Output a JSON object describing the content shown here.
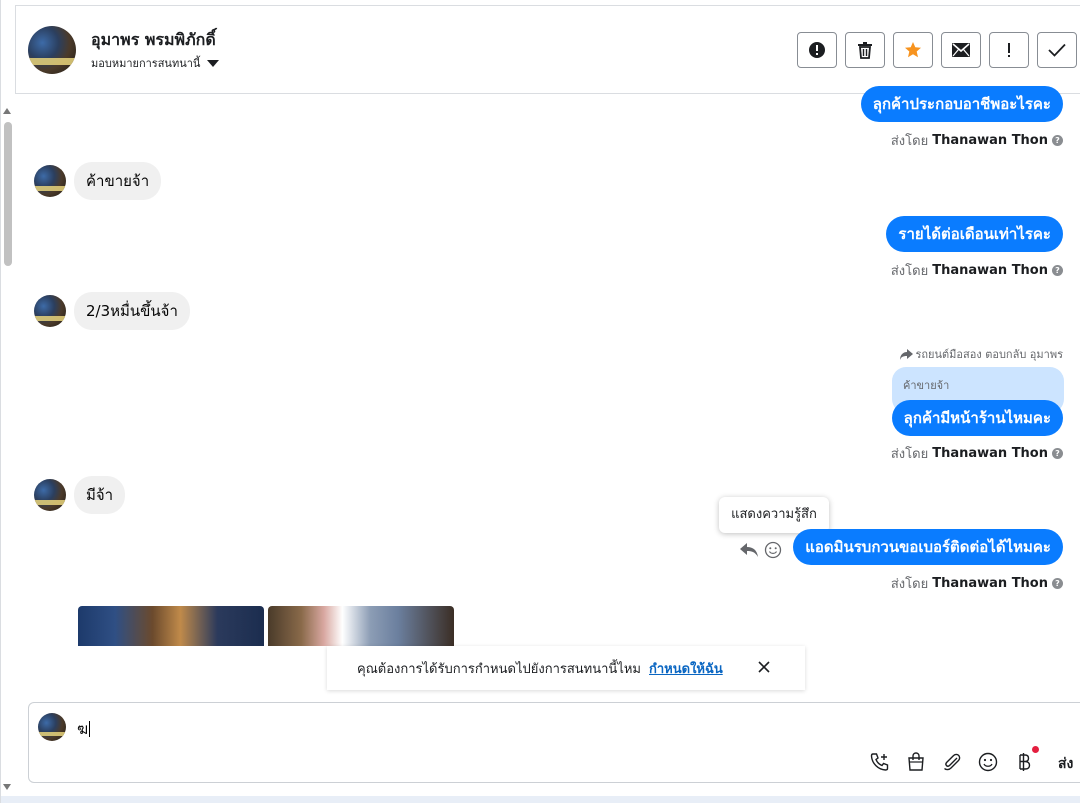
{
  "header": {
    "contact_name": "อุมาพร พรมพิภักดิ์",
    "assign_label": "มอบหมายการสนทนานี้",
    "actions": [
      {
        "name": "spam-button",
        "icon": "alert-circle-icon"
      },
      {
        "name": "delete-button",
        "icon": "trash-icon"
      },
      {
        "name": "star-button",
        "icon": "star-icon"
      },
      {
        "name": "mark-unread-button",
        "icon": "envelope-icon"
      },
      {
        "name": "flag-button",
        "icon": "exclamation-icon"
      },
      {
        "name": "done-button",
        "icon": "checkmark-icon"
      }
    ]
  },
  "messages": {
    "out1": "ลุกค้าประกอบอาชีพอะไรคะ",
    "sent_prefix": "ส่งโดย",
    "sender": "Thanawan Thon",
    "in1": "ค้าขายจ้า",
    "out2": "รายได้ต่อเดือนเท่าไรคะ",
    "in2": "2/3หมื่นขึ้นจ้า",
    "reply_context": "รถยนต์มือสอง ตอบกลับ อุมาพร",
    "quoted": "ค้าขายจ้า",
    "out3": "ลุกค้ามีหน้าร้านไหมคะ",
    "in3": "มีจ้า",
    "tooltip": "แสดงความรู้สึก",
    "out4": "แอดมินรบกวนขอเบอร์ติดต่อได้ไหมคะ"
  },
  "suggestion": {
    "text": "คุณต้องการได้รับการกำหนดไปยังการสนทนานี้ไหม",
    "link": "กำหนดให้ฉัน"
  },
  "composer": {
    "input_value": "ฆ",
    "send_label": "ส่ง",
    "tools": [
      "phone-plus-icon",
      "shopping-bag-icon",
      "paperclip-icon",
      "emoji-icon",
      "baht-icon"
    ]
  },
  "colors": {
    "accent": "#0a7cff",
    "quoted_bg": "#cce4ff",
    "star": "#f7931e",
    "link": "#0a66c2",
    "badge": "#e41e3f"
  }
}
